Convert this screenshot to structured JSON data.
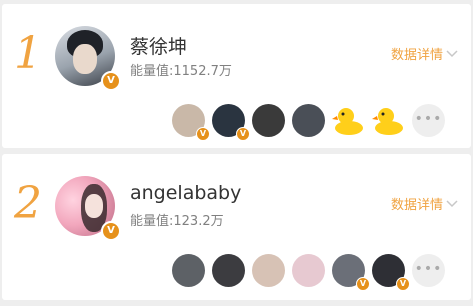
{
  "rankings": [
    {
      "rank": "1",
      "name": "蔡徐坤",
      "energy": "能量值:1152.7万",
      "details_label": "数据详情",
      "verified_mark": "V",
      "fans": [
        {
          "color": "#c9b8a8",
          "verified": true
        },
        {
          "color": "#2a3440",
          "verified": true
        },
        {
          "color": "#3a3a3a",
          "verified": false
        },
        {
          "color": "#4a4f57",
          "verified": false
        },
        {
          "icon": "rubber-duck",
          "verified": false
        },
        {
          "icon": "rubber-duck",
          "verified": false
        }
      ],
      "more_label": "•••"
    },
    {
      "rank": "2",
      "name": "angelababy",
      "energy": "能量值:123.2万",
      "details_label": "数据详情",
      "verified_mark": "V",
      "fans": [
        {
          "color": "#5d6166",
          "verified": false
        },
        {
          "color": "#3c3c40",
          "verified": false
        },
        {
          "color": "#d7c2b5",
          "verified": false
        },
        {
          "color": "#e7c9d1",
          "verified": false
        },
        {
          "color": "#6b6f78",
          "verified": true
        },
        {
          "color": "#2e2f35",
          "verified": true
        }
      ],
      "more_label": "•••"
    }
  ]
}
